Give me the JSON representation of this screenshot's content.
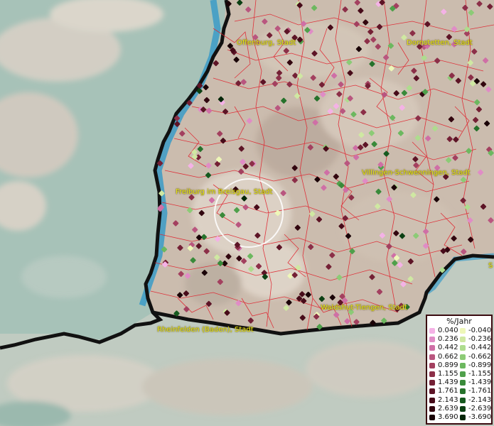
{
  "map": {
    "cities": [
      {
        "name": "Offenburg, Stadt"
      },
      {
        "name": "Dornstetten, Stadt"
      },
      {
        "name": "Villingen-Schwenningen, Stadt"
      },
      {
        "name": "Freiburg im Breisgau, Stadt"
      },
      {
        "name": "Waldshut-Tiengen, Stadt"
      },
      {
        "name": "Rheinfelden (Baden), Stadt"
      },
      {
        "name": "S"
      }
    ],
    "colors": {
      "land": "#cbbcae",
      "plain": "#a7c2b8",
      "rhine_blue": "#3b9bc7",
      "border": "#111111",
      "district_lines": "#e0232e",
      "label": "#e8e81a"
    }
  },
  "legend": {
    "title": "%/Jahr",
    "positive": [
      {
        "value": "0.040",
        "color": "#f4b2e6"
      },
      {
        "value": "0.236",
        "color": "#e08cc6"
      },
      {
        "value": "0.442",
        "color": "#cf6fa6"
      },
      {
        "value": "0.662",
        "color": "#b9567f"
      },
      {
        "value": "0.899",
        "color": "#a3405f"
      },
      {
        "value": "1.155",
        "color": "#8c2f48"
      },
      {
        "value": "1.439",
        "color": "#742035"
      },
      {
        "value": "1.761",
        "color": "#5d1426"
      },
      {
        "value": "2.143",
        "color": "#470b19"
      },
      {
        "value": "2.639",
        "color": "#32060f"
      },
      {
        "value": "3.690",
        "color": "#1a0307"
      }
    ],
    "negative": [
      {
        "value": "-0.040",
        "color": "#eef7b8"
      },
      {
        "value": "-0.236",
        "color": "#cfe8a2"
      },
      {
        "value": "-0.442",
        "color": "#aedc8e"
      },
      {
        "value": "-0.662",
        "color": "#8ccb76"
      },
      {
        "value": "-0.899",
        "color": "#6cb85f"
      },
      {
        "value": "-1.155",
        "color": "#4fa04b"
      },
      {
        "value": "-1.439",
        "color": "#398a3a"
      },
      {
        "value": "-1.761",
        "color": "#26722b"
      },
      {
        "value": "-2.143",
        "color": "#165a1f"
      },
      {
        "value": "-2.639",
        "color": "#0b4013"
      },
      {
        "value": "-3.690",
        "color": "#042608"
      }
    ]
  }
}
